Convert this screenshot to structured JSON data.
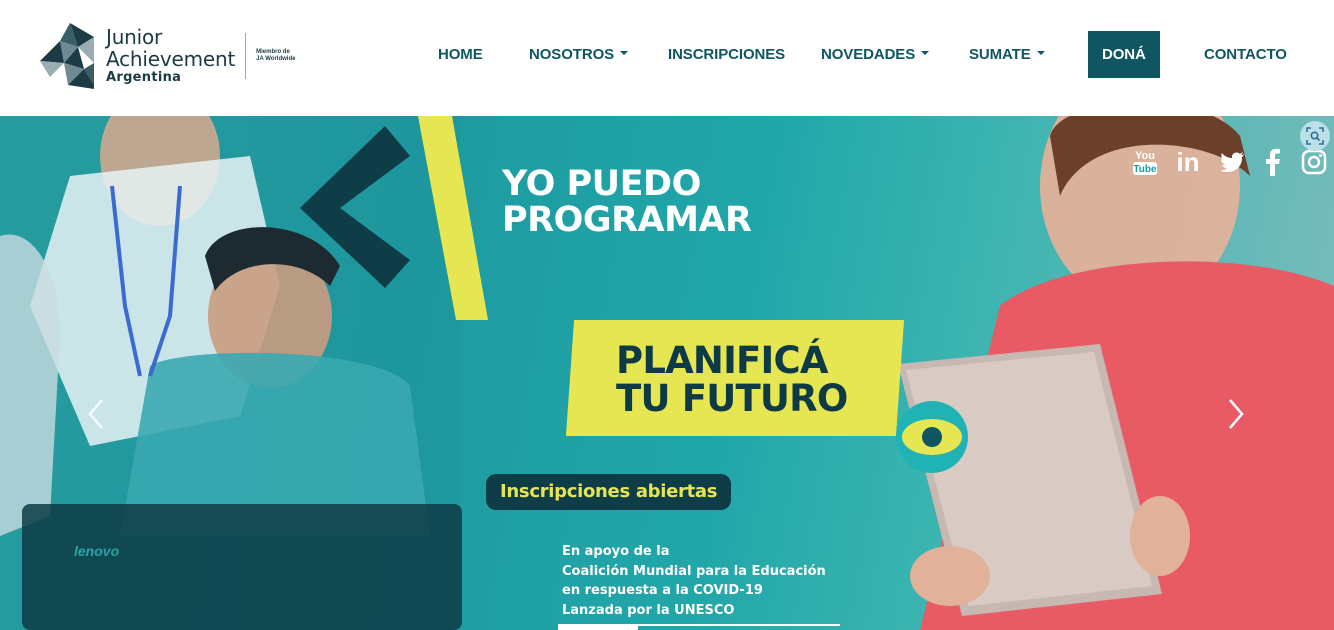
{
  "logo": {
    "line1": "Junior",
    "line2": "Achievement",
    "line3": "Argentina",
    "member_line1": "Miembro de",
    "member_line2": "JA Worldwide",
    "mark_icon": "ja-triangle-logo-icon"
  },
  "nav": {
    "items": [
      {
        "label": "HOME",
        "has_dropdown": false
      },
      {
        "label": "NOSOTROS",
        "has_dropdown": true
      },
      {
        "label": "INSCRIPCIONES",
        "has_dropdown": false
      },
      {
        "label": "NOVEDADES",
        "has_dropdown": true
      },
      {
        "label": "SUMATE",
        "has_dropdown": true
      },
      {
        "label": "DONÁ",
        "has_dropdown": false,
        "highlighted": true
      },
      {
        "label": "CONTACTO",
        "has_dropdown": false
      }
    ]
  },
  "social": {
    "icons": [
      "youtube-icon",
      "linkedin-icon",
      "twitter-icon",
      "facebook-icon",
      "instagram-icon"
    ],
    "youtube_label_1": "You",
    "youtube_label_2": "Tube",
    "linkedin_label": "in"
  },
  "hero": {
    "headline_line1": "YO PUEDO",
    "headline_line2": "PROGRAMAR",
    "plan_line1": "PLANIFICÁ",
    "plan_line2": "TU FUTURO",
    "pill": "Inscripciones abiertas",
    "note_lines": [
      "En apoyo de la",
      "Coalición Mundial para la Educación",
      "en respuesta a la COVID-19",
      "Lanzada por la UNESCO"
    ],
    "laptop_brand": "lenovo",
    "prev_icon": "chevron-left-icon",
    "next_icon": "chevron-right-icon",
    "eye_icon": "eye-icon"
  },
  "colors": {
    "brand_dark": "#0f5661",
    "accent_yellow": "#e6e552",
    "hero_teal": "#21a7a9",
    "text_dark": "#0d3a45"
  }
}
